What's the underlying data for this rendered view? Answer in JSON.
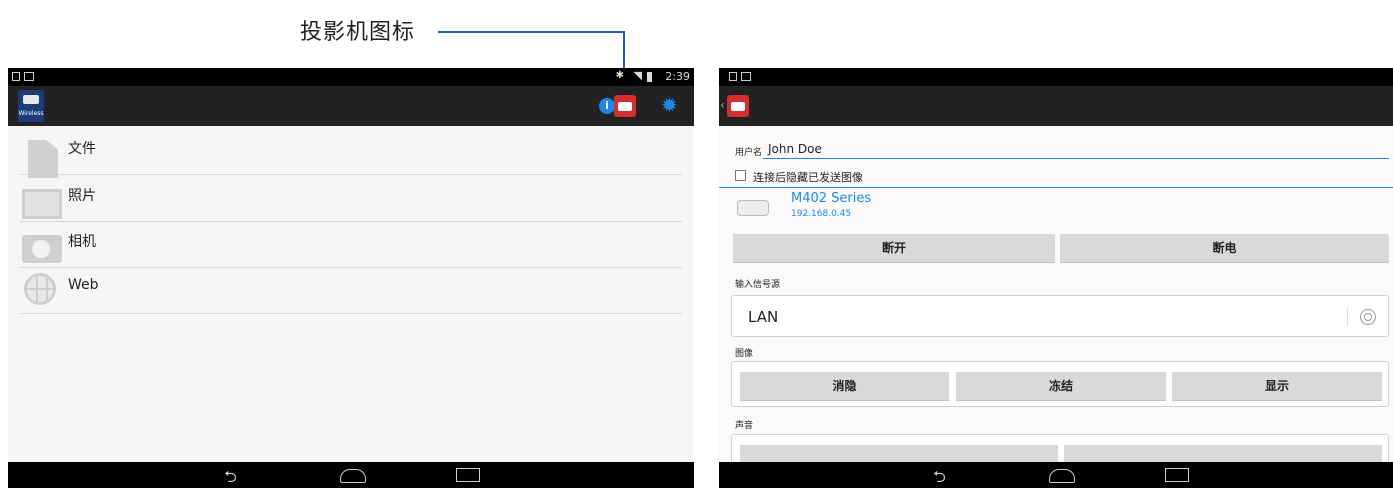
{
  "callout": {
    "label": "投影机图标"
  },
  "left_screen": {
    "status": {
      "time": "2:39"
    },
    "app_logo_text": "Wireless",
    "list": [
      {
        "label": "文件",
        "icon": "file-icon"
      },
      {
        "label": "照片",
        "icon": "photo-icon"
      },
      {
        "label": "相机",
        "icon": "camera-icon"
      },
      {
        "label": "Web",
        "icon": "globe-icon"
      }
    ]
  },
  "right_screen": {
    "username_label": "用户名",
    "username_value": "John Doe",
    "hide_after_connect_label": "连接后隐藏已发送图像",
    "device": {
      "name": "M402 Series",
      "ip": "192.168.0.45"
    },
    "buttons": {
      "disconnect": "断开",
      "power_off": "断电"
    },
    "input_source_label": "输入信号源",
    "input_source_value": "LAN",
    "image_section_label": "图像",
    "image_buttons": {
      "blank": "消隐",
      "freeze": "冻结",
      "show": "显示"
    },
    "audio_section_label": "声音"
  },
  "colors": {
    "accent": "#1e88e5",
    "projector_red": "#d32f2f",
    "callout_line": "#1565c0"
  }
}
